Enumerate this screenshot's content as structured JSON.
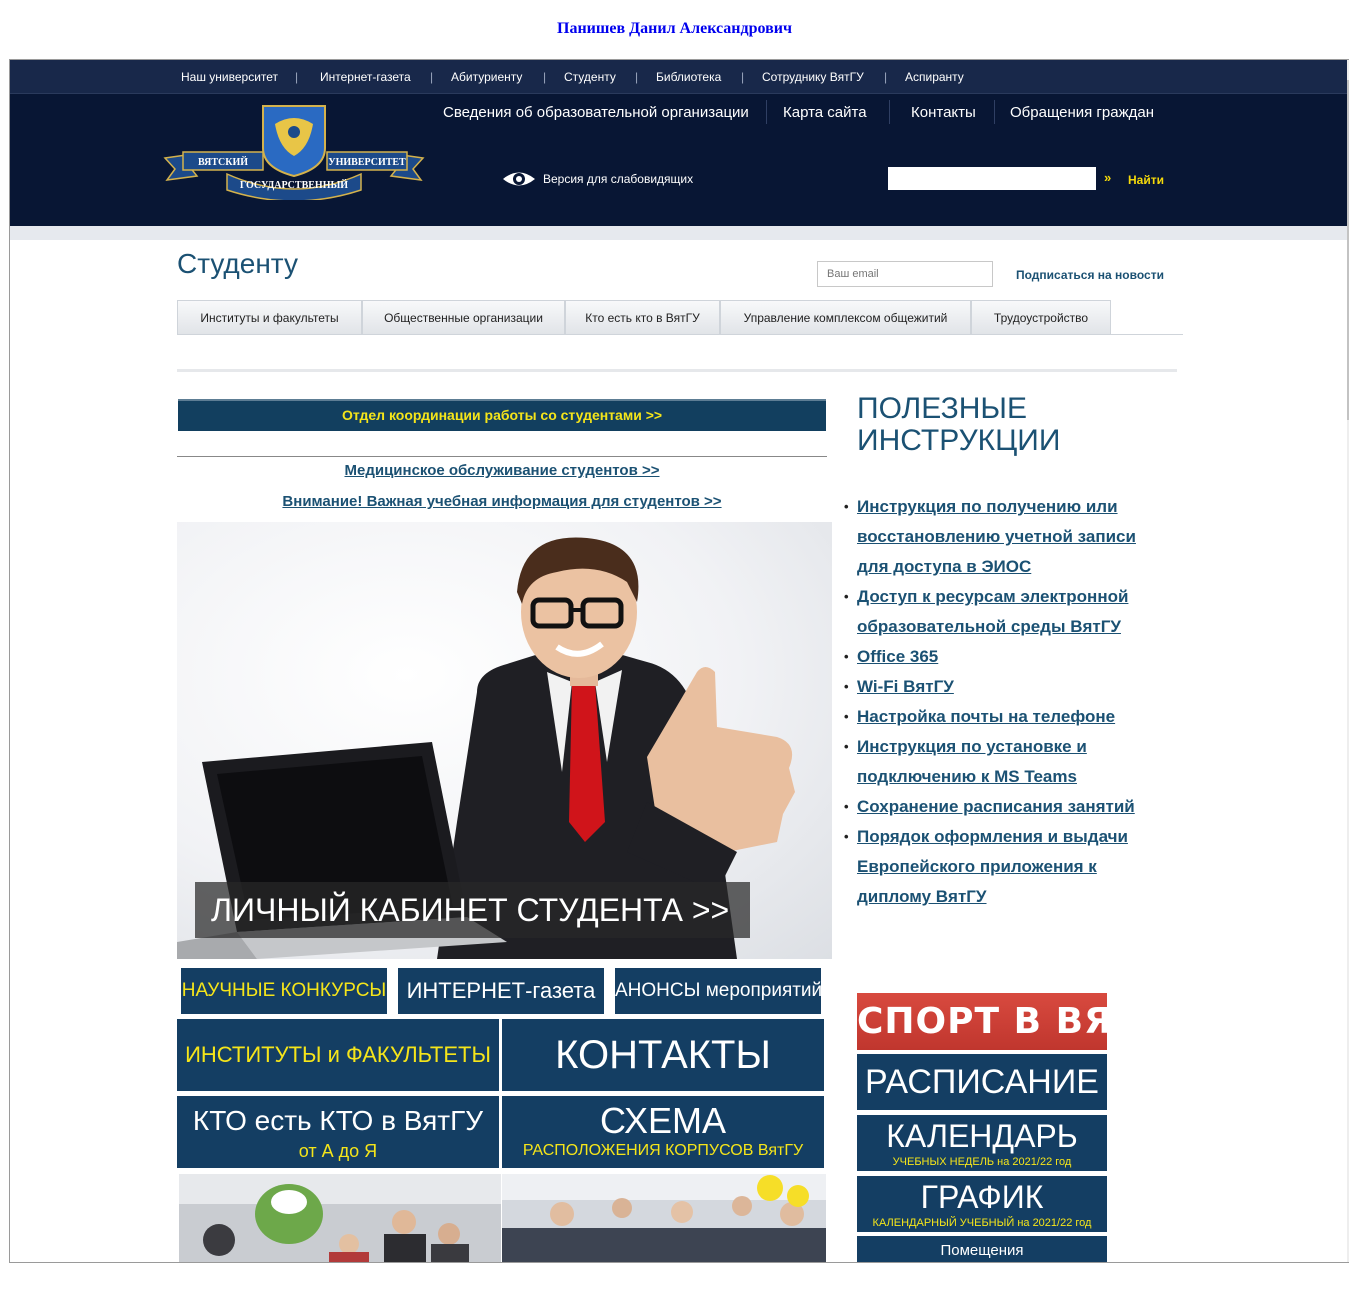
{
  "owner_name": "Панишев Данил Александрович",
  "topnav": [
    "Наш университет",
    "Интернет-газета",
    "Абитуриенту",
    "Студенту",
    "Библиотека",
    "Сотруднику ВятГУ",
    "Аспиранту"
  ],
  "header": {
    "logo_text": [
      "ВЯТСКИЙ",
      "ГОСУДАРСТВЕННЫЙ",
      "УНИВЕРСИТЕТ"
    ],
    "main_links": [
      "Сведения об образовательной организации",
      "Карта сайта",
      "Контакты",
      "Обращения граждан"
    ],
    "low_vision": "Версия для слабовидящих",
    "search_value": "",
    "search_arrow": "»",
    "search_button": "Найти"
  },
  "page": {
    "title": "Студенту",
    "email_placeholder": "Ваш email",
    "subscribe": "Подписаться на новости"
  },
  "tabs": [
    "Институты и факультеты",
    "Общественные организации",
    "Кто есть кто в ВятГУ",
    "Управление комплексом общежитий",
    "Трудоустройство"
  ],
  "left": {
    "coord_banner": "Отдел координации работы со студентами >>",
    "links": [
      "Медицинское обслуживание студентов >>",
      "Внимание! Важная учебная информация для студентов >>"
    ],
    "hero_caption": "ЛИЧНЫЙ КАБИНЕТ СТУДЕНТА >>",
    "tiles_small": [
      "НАУЧНЫЕ КОНКУРСЫ",
      "ИНТЕРНЕТ-газета",
      "АНОНСЫ мероприятий"
    ],
    "tile_institutes": "ИНСТИТУТЫ и ФАКУЛЬТЕТЫ",
    "tile_contacts": "КОНТАКТЫ",
    "tile_who": {
      "line1": "КТО есть КТО в ВятГУ",
      "line2": "от А до Я"
    },
    "tile_scheme": {
      "line1": "СХЕМА",
      "line2": "РАСПОЛОЖЕНИЯ КОРПУСОВ ВятГУ"
    }
  },
  "right": {
    "instructions_title": [
      "ПОЛЕЗНЫЕ",
      "ИНСТРУКЦИИ"
    ],
    "instructions": [
      [
        "Инструкция по получению или",
        "восстановлению учетной записи",
        "для доступа в ЭИОС"
      ],
      [
        "Доступ к ресурсам электронной",
        "образовательной среды ВятГУ"
      ],
      [
        "Office 365"
      ],
      [
        "Wi-Fi ВятГУ"
      ],
      [
        "Настройка почты на телефоне"
      ],
      [
        "Инструкция по установке и",
        "подключению к MS Teams"
      ],
      [
        "Сохранение расписания занятий"
      ],
      [
        "Порядок оформления и выдачи",
        "Европейского приложения к",
        "диплому ВятГУ"
      ]
    ],
    "sport": "СПОРТ В ВЯТГУ",
    "schedule": "РАСПИСАНИЕ",
    "calendar": {
      "title": "КАЛЕНДАРЬ",
      "sub": "УЧЕБНЫХ НЕДЕЛЬ на 2021/22 год"
    },
    "graph": {
      "title": "ГРАФИК",
      "sub": "КАЛЕНДАРНЫЙ УЧЕБНЫЙ на 2021/22 год"
    },
    "rooms": "Помещения"
  },
  "colors": {
    "header_bg": "#081634",
    "accent_blue": "#1b5173",
    "tile_blue": "#143e63",
    "accent_yellow": "#f5e51a",
    "sport_red": "#c9403a"
  }
}
